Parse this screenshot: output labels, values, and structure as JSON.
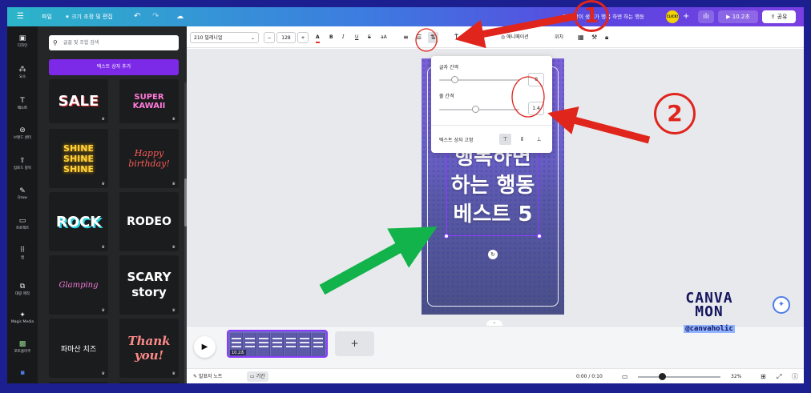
{
  "topbar": {
    "menu_icon": "menu-icon",
    "file": "파일",
    "resize": "크기 조정 및 편집",
    "doc_title": "인스 감이 생기가 행복 하면 하는 행동",
    "avatar_label": "CLICK!",
    "duration": "10.2초",
    "share": "공유"
  },
  "rail": {
    "items": [
      {
        "label": "디자인",
        "icon": "layout-icon"
      },
      {
        "label": "요소",
        "icon": "shapes-icon"
      },
      {
        "label": "텍스트",
        "icon": "text-icon"
      },
      {
        "label": "브랜드 센터",
        "icon": "brand-icon"
      },
      {
        "label": "업로드 항목",
        "icon": "upload-icon"
      },
      {
        "label": "Draw",
        "icon": "draw-icon"
      },
      {
        "label": "프로젝트",
        "icon": "folder-icon"
      },
      {
        "label": "앱",
        "icon": "apps-icon"
      },
      {
        "label": "대량 제작",
        "icon": "bulk-icon"
      },
      {
        "label": "Magic Media",
        "icon": "magic-icon"
      },
      {
        "label": "포토콜라주",
        "icon": "collage-icon"
      }
    ]
  },
  "panel": {
    "search_placeholder": "글꼴 및 조합 검색",
    "add_text_button": "텍스트 상자 추가",
    "tiles": [
      {
        "text": "SALE",
        "color": "#ffffff"
      },
      {
        "text": "SUPER KAWAII",
        "color": "#ff7ad9"
      },
      {
        "text": "SHINE SHINE SHINE",
        "color": "#ffd43a"
      },
      {
        "text": "Happy birthday!",
        "color": "#ff5a5a"
      },
      {
        "text": "ROCK",
        "color": "#2ad3e0"
      },
      {
        "text": "RODEO",
        "color": "#ffffff"
      },
      {
        "text": "Glamping",
        "color": "#f07ad6"
      },
      {
        "text": "SCARY story",
        "color": "#ff6a5a"
      },
      {
        "text": "파마산 치즈",
        "color": "#ffffff"
      },
      {
        "text": "Thank you!",
        "color": "#ff8a8a"
      }
    ]
  },
  "toolbar": {
    "font": "210 빌레니얼",
    "size": "128",
    "minus": "−",
    "plus": "+",
    "bold": "B",
    "italic": "I",
    "underline": "U",
    "strike": "S",
    "case": "aA",
    "animate": "애니메이션",
    "position": "위치"
  },
  "spacing_popup": {
    "letter_spacing_label": "글자 간격",
    "letter_spacing_value": "0",
    "line_spacing_label": "줄 간격",
    "line_spacing_value": "1.4",
    "anchor_label": "텍스트 상자 고정"
  },
  "design": {
    "lines": [
      "행복하면",
      "하는 행동",
      "베스트 5"
    ]
  },
  "timeline": {
    "frame_label": "10.2초",
    "add_page": "+"
  },
  "bottombar": {
    "notes": "발표자 노트",
    "duration": "기간",
    "time": "0:00 / 0:10",
    "zoom": "32%"
  },
  "annotations": {
    "one": "1",
    "two": "2",
    "arrow_red": "#e0251d",
    "arrow_green": "#12b34a"
  },
  "watermark": {
    "line1": "CANVA",
    "line2": "MON",
    "handle": "@canvaholic"
  }
}
